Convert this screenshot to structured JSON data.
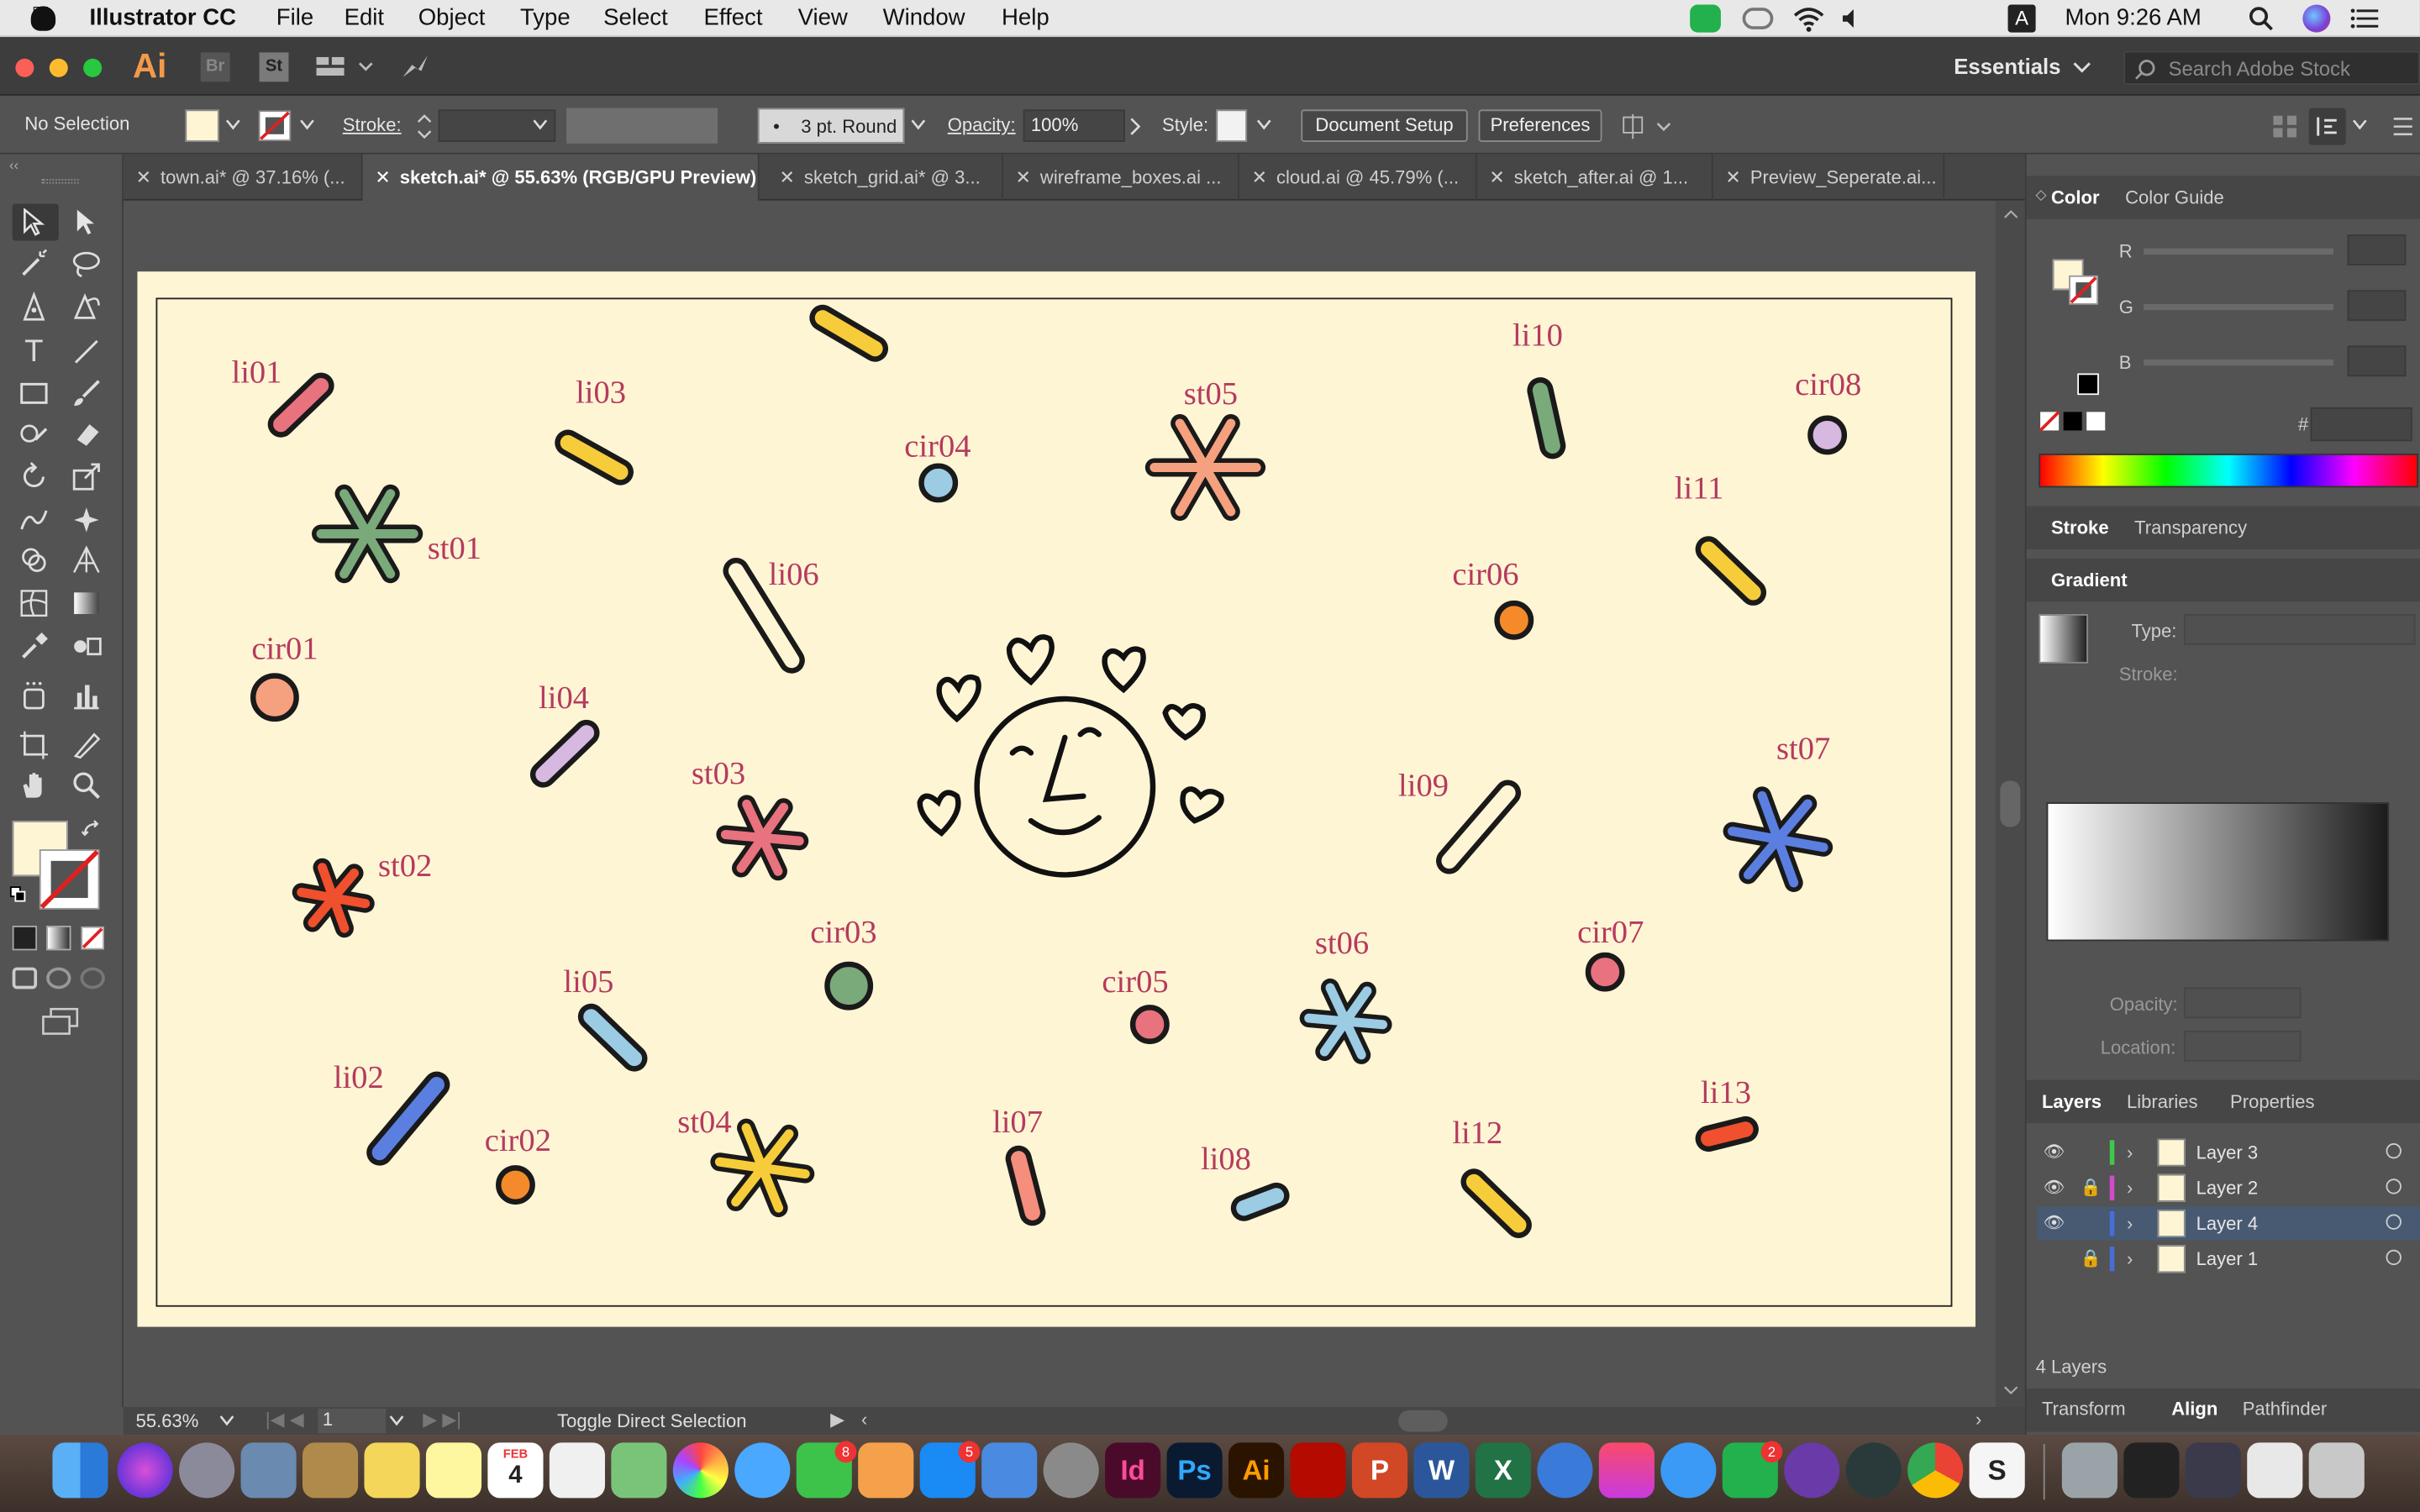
{
  "menubar": {
    "app_name": "Illustrator CC",
    "menus": [
      "File",
      "Edit",
      "Object",
      "Type",
      "Select",
      "Effect",
      "View",
      "Window",
      "Help"
    ],
    "clock": "Mon 9:26 AM",
    "input_source": "A"
  },
  "appbar": {
    "ai_logo": "Ai",
    "br_label": "Br",
    "st_label": "St",
    "workspace": "Essentials",
    "search_placeholder": "Search Adobe Stock"
  },
  "control": {
    "selection": "No Selection",
    "stroke_label": "Stroke:",
    "brush": "3 pt. Round",
    "opacity_label": "Opacity:",
    "opacity_value": "100%",
    "style_label": "Style:",
    "doc_setup": "Document Setup",
    "preferences": "Preferences"
  },
  "tabs": [
    {
      "label": "town.ai* @ 37.16% (...",
      "active": false
    },
    {
      "label": "sketch.ai* @ 55.63% (RGB/GPU Preview)",
      "active": true
    },
    {
      "label": "sketch_grid.ai* @ 3...",
      "active": false
    },
    {
      "label": "wireframe_boxes.ai ...",
      "active": false
    },
    {
      "label": "cloud.ai @ 45.79% (...",
      "active": false
    },
    {
      "label": "sketch_after.ai @ 1...",
      "active": false
    },
    {
      "label": "Preview_Seperate.ai...",
      "active": false
    }
  ],
  "artwork_labels": {
    "li01": "li01",
    "li02": "li02",
    "li03": "li03",
    "li04": "li04",
    "li05": "li05",
    "li06": "li06",
    "li07": "li07",
    "li08": "li08",
    "li09": "li09",
    "li10": "li10",
    "li11": "li11",
    "li12": "li12",
    "li13": "li13",
    "st01": "st01",
    "st02": "st02",
    "st03": "st03",
    "st04": "st04",
    "st05": "st05",
    "st06": "st06",
    "st07": "st07",
    "cir01": "cir01",
    "cir02": "cir02",
    "cir03": "cir03",
    "cir04": "cir04",
    "cir05": "cir05",
    "cir06": "cir06",
    "cir07": "cir07",
    "cir08": "cir08"
  },
  "panels": {
    "color_tab": "Color",
    "color_guide_tab": "Color Guide",
    "r": "R",
    "g": "G",
    "b": "B",
    "hash": "#",
    "stroke_tab": "Stroke",
    "transparency_tab": "Transparency",
    "gradient_tab": "Gradient",
    "type_label": "Type:",
    "stroke_label": "Stroke:",
    "opacity_label": "Opacity:",
    "location_label": "Location:",
    "layers_tab": "Layers",
    "libraries_tab": "Libraries",
    "properties_tab": "Properties",
    "layers": [
      {
        "name": "Layer 3",
        "color": "#3fc84a",
        "visible": true,
        "locked": false,
        "selected": false
      },
      {
        "name": "Layer 2",
        "color": "#d24cc8",
        "visible": true,
        "locked": true,
        "selected": false
      },
      {
        "name": "Layer 4",
        "color": "#4a6cd6",
        "visible": true,
        "locked": false,
        "selected": true
      },
      {
        "name": "Layer 1",
        "color": "#4a6cd6",
        "visible": false,
        "locked": true,
        "selected": false
      }
    ],
    "layer_count": "4 Layers",
    "transform_tab": "Transform",
    "align_tab": "Align",
    "pathfinder_tab": "Pathfinder"
  },
  "status": {
    "zoom": "55.63%",
    "page": "1",
    "hint": "Toggle Direct Selection"
  },
  "dock": {
    "calendar_month": "FEB",
    "calendar_day": "4",
    "messages_badge": "8",
    "appstore_badge": "5",
    "line_badge": "2",
    "apps": [
      "Id",
      "Ps",
      "Ai",
      "Acrobat",
      "PowerPoint",
      "Word",
      "Excel"
    ],
    "id": "Id",
    "ps": "Ps",
    "ai": "Ai",
    "p": "P",
    "w": "W",
    "x": "X",
    "s": "S"
  },
  "colors": {
    "artboard": "#fef5d4",
    "label": "#b53a5e",
    "pink": "#e8727e",
    "yellow": "#f7cc3a",
    "green": "#7aa97a",
    "lavender": "#d6b8e0",
    "blue": "#5b7fe0",
    "lightblue": "#9ccbe4",
    "salmon": "#f5a07e",
    "orange": "#f58a2a",
    "red": "#f0502e"
  }
}
